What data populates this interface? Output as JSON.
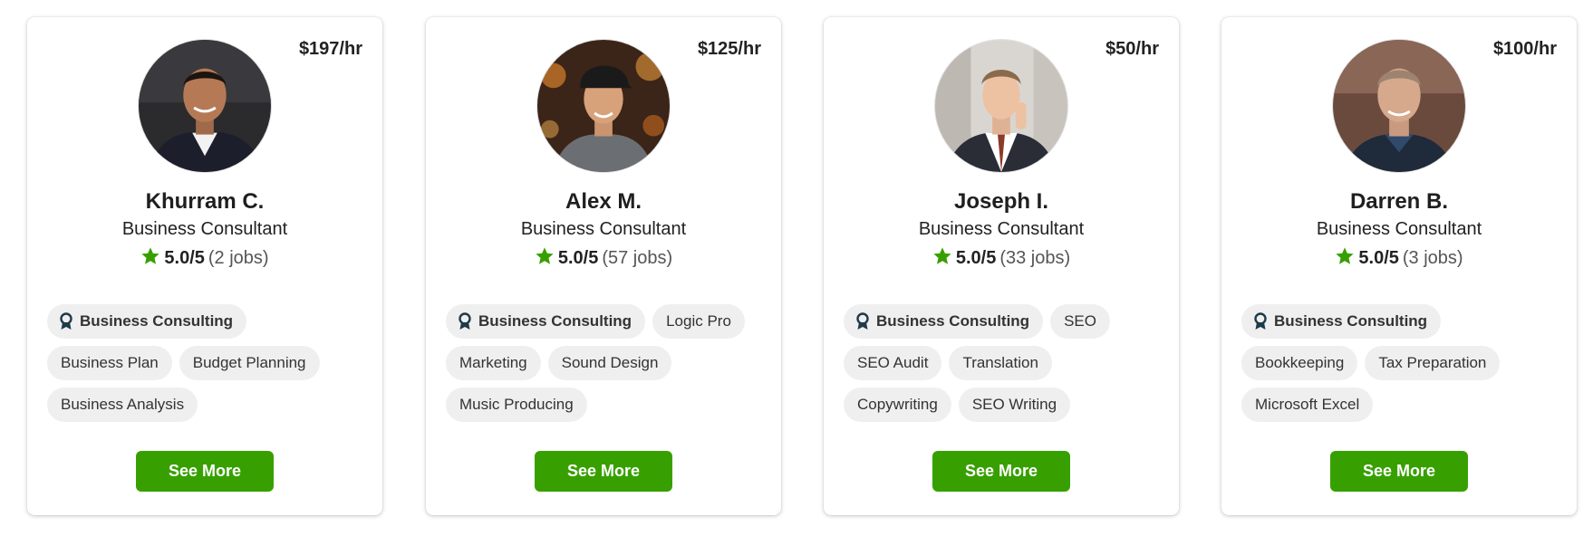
{
  "colors": {
    "accent": "#37a000",
    "star": "#37a000",
    "tag_bg": "#efefef",
    "badge": "#1f3a4a"
  },
  "freelancers": [
    {
      "rate": "$197/hr",
      "name": "Khurram C.",
      "title": "Business Consultant",
      "score": "5.0/5",
      "jobs": "(2 jobs)",
      "top_skill": "Business Consulting",
      "skills": [
        "Business Plan",
        "Budget Planning",
        "Business Analysis"
      ],
      "button": "See More",
      "avatar_icon": "profile-photo"
    },
    {
      "rate": "$125/hr",
      "name": "Alex M.",
      "title": "Business Consultant",
      "score": "5.0/5",
      "jobs": "(57 jobs)",
      "top_skill": "Business Consulting",
      "skills": [
        "Logic Pro",
        "Marketing",
        "Sound Design",
        "Music Producing"
      ],
      "button": "See More",
      "avatar_icon": "profile-photo"
    },
    {
      "rate": "$50/hr",
      "name": "Joseph I.",
      "title": "Business Consultant",
      "score": "5.0/5",
      "jobs": "(33 jobs)",
      "top_skill": "Business Consulting",
      "skills": [
        "SEO",
        "SEO Audit",
        "Translation",
        "Copywriting",
        "SEO Writing"
      ],
      "button": "See More",
      "avatar_icon": "profile-photo"
    },
    {
      "rate": "$100/hr",
      "name": "Darren B.",
      "title": "Business Consultant",
      "score": "5.0/5",
      "jobs": "(3 jobs)",
      "top_skill": "Business Consulting",
      "skills": [
        "Bookkeeping",
        "Tax Preparation",
        "Microsoft Excel"
      ],
      "button": "See More",
      "avatar_icon": "profile-photo"
    }
  ]
}
